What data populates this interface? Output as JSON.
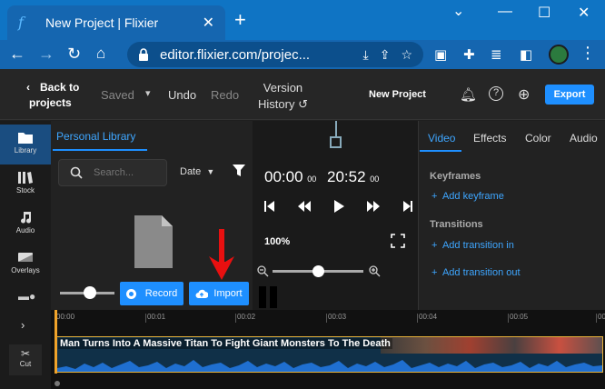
{
  "browser": {
    "tab_title": "New Project | Flixier",
    "url": "editor.flixier.com/projec..."
  },
  "header": {
    "back_line1": "Back to",
    "back_line2": "projects",
    "saved": "Saved",
    "undo": "Undo",
    "redo": "Redo",
    "version_line1": "Version",
    "version_line2": "History",
    "project_name": "New Project",
    "export": "Export"
  },
  "rail": {
    "items": [
      {
        "label": "Library",
        "icon": "folder-icon"
      },
      {
        "label": "Stock",
        "icon": "stock-icon"
      },
      {
        "label": "Audio",
        "icon": "music-note-icon"
      },
      {
        "label": "Overlays",
        "icon": "overlays-icon"
      }
    ]
  },
  "library": {
    "tab": "Personal Library",
    "search_placeholder": "Search...",
    "sort": "Date",
    "record": "Record",
    "import": "Import"
  },
  "preview": {
    "current_time": "00:00",
    "current_frames": "00",
    "total_time": "20:52",
    "total_frames": "00",
    "zoom": "100%"
  },
  "panel": {
    "tabs": [
      "Video",
      "Effects",
      "Color",
      "Audio"
    ],
    "keyframes_heading": "Keyframes",
    "add_keyframe": "Add keyframe",
    "transitions_heading": "Transitions",
    "add_transition_in": "Add transition in",
    "add_transition_out": "Add transition out"
  },
  "timeline": {
    "ticks": [
      "00:00",
      "00:01",
      "00:02",
      "00:03",
      "00:04",
      "00:05",
      "00:0"
    ],
    "clip_title": "Man Turns Into A Massive Titan To Fight Giant Monsters To The Death",
    "cut": "Cut"
  },
  "colors": {
    "accent": "#1e8fff",
    "chrome": "#0f74c4",
    "clip_border": "#e6b13a"
  }
}
